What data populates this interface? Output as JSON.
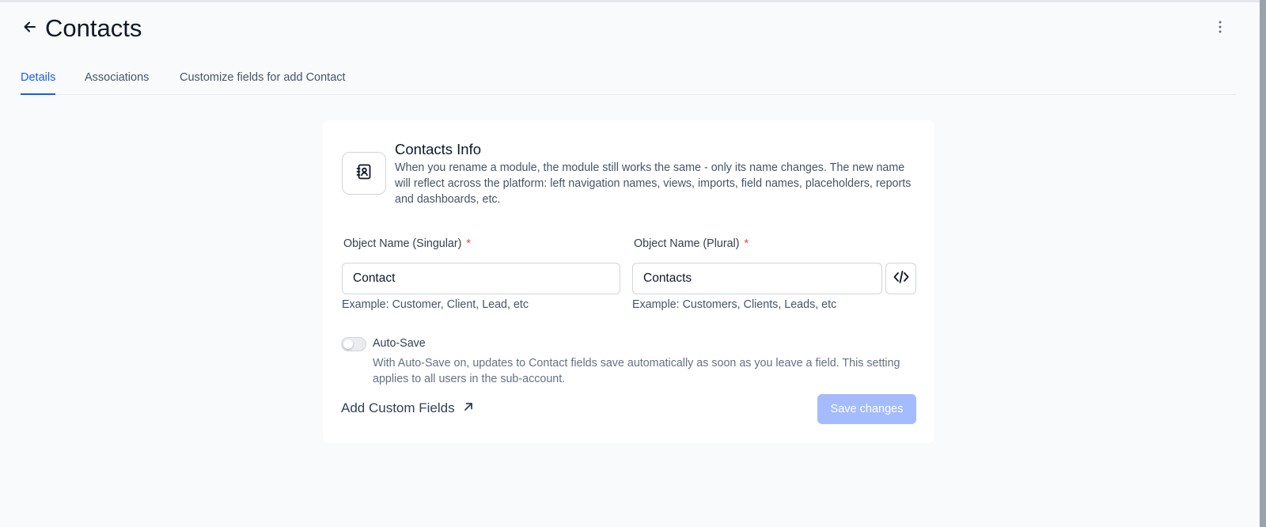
{
  "header": {
    "title": "Contacts",
    "back_icon": "arrow-left-icon",
    "more_icon": "dots-vertical-icon"
  },
  "tabs": [
    {
      "label": "Details",
      "active": true
    },
    {
      "label": "Associations",
      "active": false
    },
    {
      "label": "Customize fields for add Contact",
      "active": false
    }
  ],
  "card": {
    "icon": "contact-book-icon",
    "title": "Contacts Info",
    "description": "When you rename a module, the module still works the same - only its name changes. The new name will reflect across the platform: left navigation names, views, imports, field names, placeholders, reports and dashboards, etc."
  },
  "form": {
    "singular": {
      "label": "Object Name (Singular)",
      "required_mark": "*",
      "value": "Contact",
      "help": "Example: Customer, Client, Lead, etc"
    },
    "plural": {
      "label": "Object Name (Plural)",
      "required_mark": "*",
      "value": "Contacts",
      "help": "Example: Customers, Clients, Leads, etc"
    },
    "code_icon": "code-icon"
  },
  "autosave": {
    "label": "Auto-Save",
    "enabled": false,
    "description": "With Auto-Save on, updates to Contact fields save automatically as soon as you leave a field. This setting applies to all users in the sub-account."
  },
  "actions": {
    "custom_fields_label": "Add Custom Fields",
    "custom_fields_icon": "arrow-up-right-icon",
    "save_label": "Save changes"
  },
  "colors": {
    "accent": "#155eef",
    "save_disabled": "#a4bcfd",
    "required": "#f04438"
  }
}
